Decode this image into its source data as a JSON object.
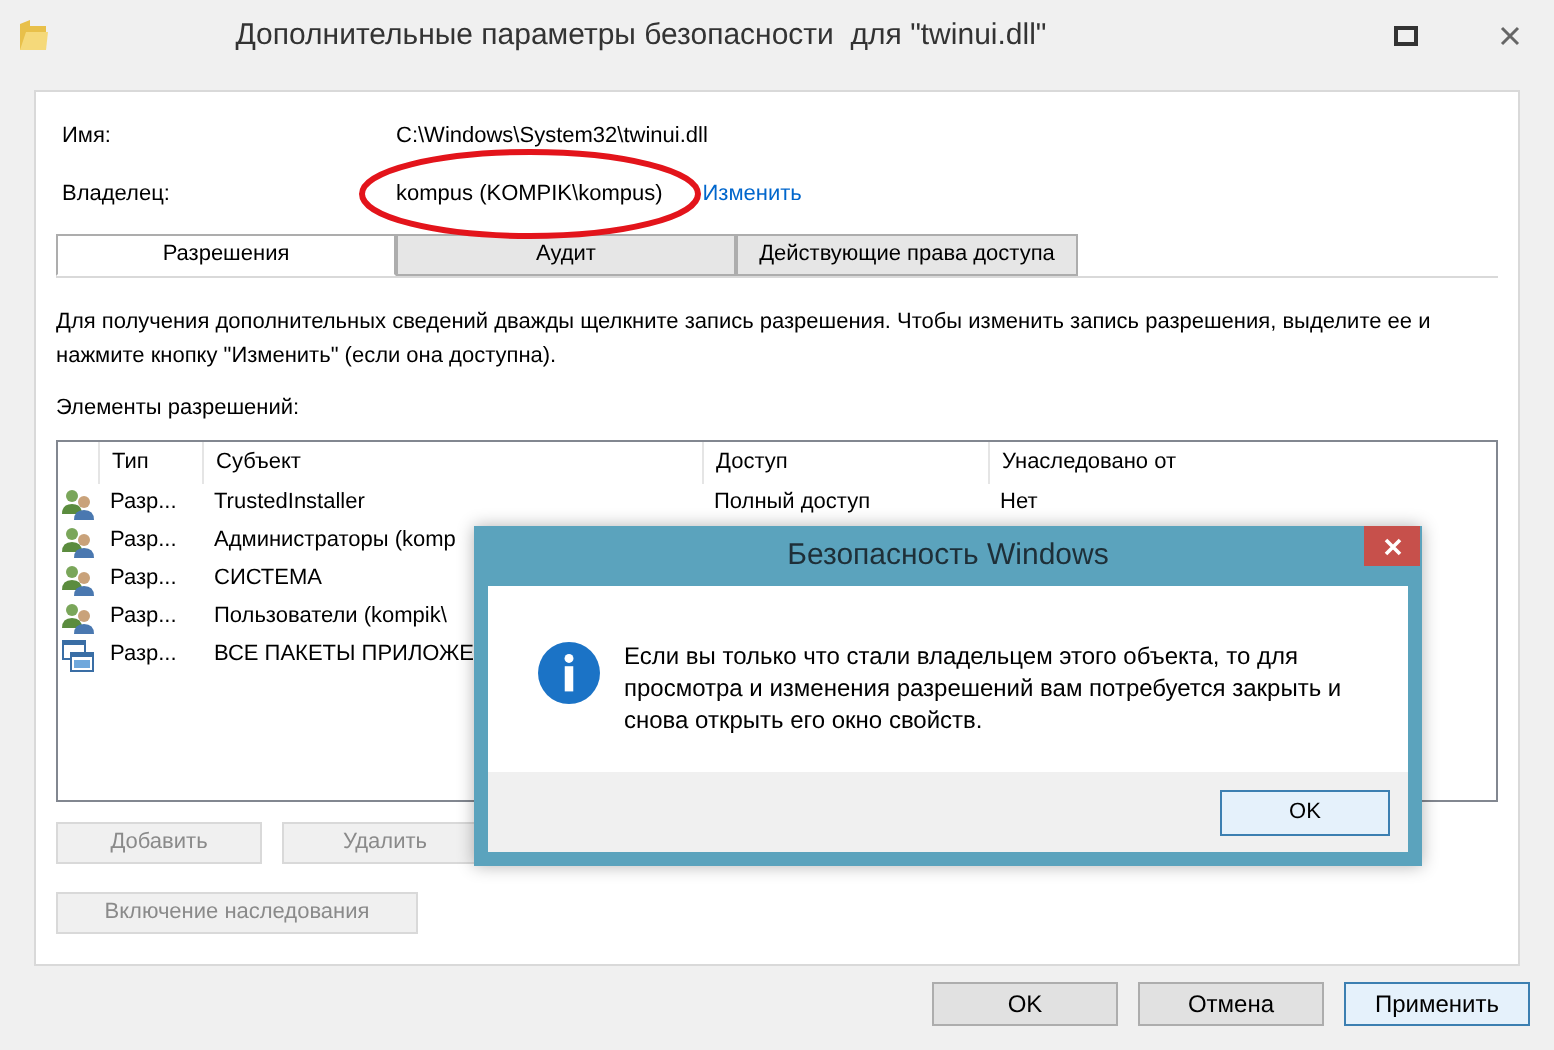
{
  "window": {
    "title": "Дополнительные параметры безопасности  для \"twinui.dll\""
  },
  "fields": [
    {
      "label": "Имя:",
      "value": "C:\\Windows\\System32\\twinui.dll"
    },
    {
      "label": "Владелец:",
      "value": "kompus (KOMPIK\\kompus)",
      "link": "Изменить",
      "circled": true
    }
  ],
  "tabs": [
    {
      "label": "Разрешения",
      "selected": true
    },
    {
      "label": "Аудит",
      "selected": false
    },
    {
      "label": "Действующие права доступа",
      "selected": false
    }
  ],
  "instructions": "Для получения дополнительных сведений дважды щелкните запись разрешения. Чтобы изменить запись разрешения, выделите ее и нажмите кнопку \"Изменить\" (если она доступна).",
  "table": {
    "caption": "Элементы разрешений:",
    "columns": [
      "Тип",
      "Субъект",
      "Доступ",
      "Унаследовано от"
    ],
    "rows": [
      {
        "kind": "users",
        "type": "Разр...",
        "subject": "TrustedInstaller",
        "access": "Полный доступ",
        "inherited": "Нет"
      },
      {
        "kind": "users",
        "type": "Разр...",
        "subject": "Администраторы (komp"
      },
      {
        "kind": "users",
        "type": "Разр...",
        "subject": "СИСТЕМА"
      },
      {
        "kind": "users",
        "type": "Разр...",
        "subject": "Пользователи (kompik\\"
      },
      {
        "kind": "packages",
        "type": "Разр...",
        "subject": "ВСЕ ПАКЕТЫ ПРИЛОЖЕ"
      }
    ]
  },
  "table_buttons": [
    {
      "label": "Добавить",
      "disabled": true
    },
    {
      "label": "Удалить",
      "disabled": true
    }
  ],
  "inherit_button": {
    "label": "Включение наследования",
    "disabled": true
  },
  "footer_buttons": [
    {
      "label": "OK",
      "selected": false
    },
    {
      "label": "Отмена",
      "selected": false
    },
    {
      "label": "Применить",
      "selected": true
    }
  ],
  "dialog": {
    "title": "Безопасность Windows",
    "message": "Если вы только что стали владельцем этого объекта, то для просмотра и изменения разрешений вам потребуется закрыть и снова открыть его окно свойств.",
    "button": "OK"
  }
}
